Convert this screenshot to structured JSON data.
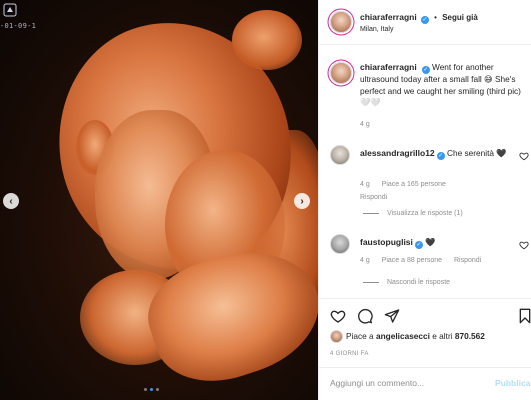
{
  "media": {
    "timestamp": "-01-09-1",
    "slide_count": 3,
    "active_slide": 1
  },
  "post": {
    "author": {
      "username": "chiaraferragni",
      "verified": true,
      "follow_label": "Segui già",
      "location": "Milan, Italy"
    },
    "caption": {
      "username": "chiaraferragni",
      "text": "Went for another ultrasound today after a small fall 😅 She's perfect and we caught her smiling (third pic) 🤍🤍",
      "time": "4 g"
    },
    "comments": [
      {
        "username": "alessandragrillo12",
        "verified": true,
        "text": "Che serenità 🖤",
        "time": "4 g",
        "likes": "Piace a 165 persone",
        "reply_label": "Rispondi",
        "replies_label": "Visualizza le risposte (1)"
      },
      {
        "username": "faustopuglisi",
        "verified": true,
        "text": "🖤",
        "time": "4 g",
        "likes": "Piace a 88 persone",
        "reply_label": "Rispondi",
        "replies_label": "Nascondi le risposte"
      }
    ],
    "likes": {
      "prefix": "Piace a ",
      "user": "angelicasecci",
      "middle": " e altri ",
      "count": "870.562"
    },
    "age": "4 GIORNI FA",
    "add_comment": {
      "placeholder": "Aggiungi un commento...",
      "publish_label": "Pubblica"
    }
  },
  "icons": {
    "like": "heart-icon",
    "comment": "comment-bubble-icon",
    "share": "paper-plane-icon"
  },
  "colors": {
    "verified": "#3897f0",
    "secondary_text": "#8e8e8e",
    "publish_disabled": "#b2dffc"
  }
}
